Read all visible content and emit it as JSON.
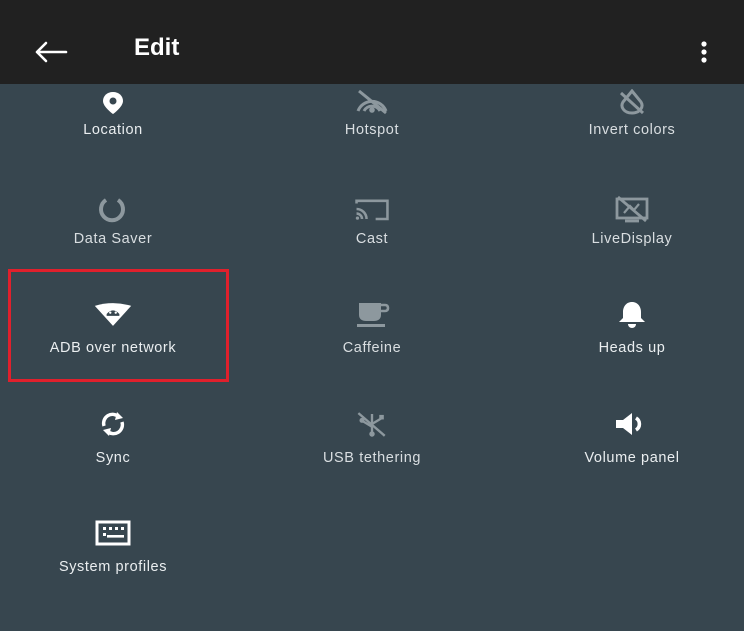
{
  "header": {
    "title": "Edit",
    "back_icon": "arrow-left-icon",
    "menu_icon": "more-vert-icon"
  },
  "tiles": [
    {
      "label": "Location",
      "icon": "location-pin-icon",
      "active": true
    },
    {
      "label": "Hotspot",
      "icon": "hotspot-icon",
      "active": false
    },
    {
      "label": "Invert colors",
      "icon": "invert-colors-icon",
      "active": false
    },
    {
      "label": "Data Saver",
      "icon": "data-saver-icon",
      "active": false
    },
    {
      "label": "Cast",
      "icon": "cast-icon",
      "active": false
    },
    {
      "label": "LiveDisplay",
      "icon": "livedisplay-icon",
      "active": false
    },
    {
      "label": "ADB over network",
      "icon": "adb-network-icon",
      "active": true
    },
    {
      "label": "Caffeine",
      "icon": "coffee-cup-icon",
      "active": false
    },
    {
      "label": "Heads up",
      "icon": "bell-icon",
      "active": true
    },
    {
      "label": "Sync",
      "icon": "sync-icon",
      "active": true
    },
    {
      "label": "USB tethering",
      "icon": "usb-tethering-icon",
      "active": false
    },
    {
      "label": "Volume panel",
      "icon": "volume-icon",
      "active": true
    },
    {
      "label": "System profiles",
      "icon": "system-profiles-icon",
      "active": true
    }
  ],
  "colors": {
    "app_bar": "#212121",
    "background": "#37464f",
    "icon_active": "#ffffff",
    "icon_inactive": "#8d989e",
    "highlight": "#e0202c"
  }
}
